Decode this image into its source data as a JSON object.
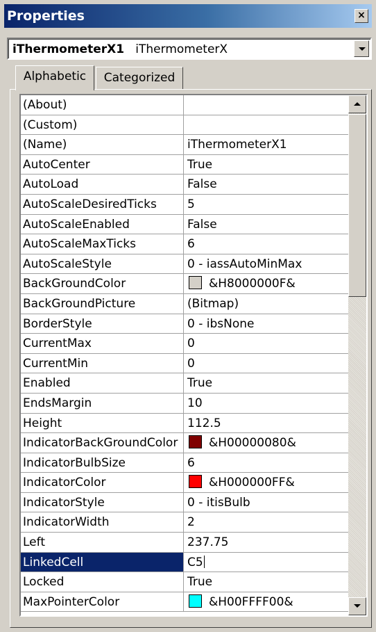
{
  "window": {
    "title": "Properties",
    "close_glyph": "×"
  },
  "object_selector": {
    "name": "iThermometerX1",
    "type": "iThermometerX"
  },
  "tabs": [
    {
      "label": "Alphabetic",
      "active": true
    },
    {
      "label": "Categorized",
      "active": false
    }
  ],
  "properties": [
    {
      "name": "(About)",
      "value": ""
    },
    {
      "name": "(Custom)",
      "value": ""
    },
    {
      "name": "(Name)",
      "value": "iThermometerX1"
    },
    {
      "name": "AutoCenter",
      "value": "True"
    },
    {
      "name": "AutoLoad",
      "value": "False"
    },
    {
      "name": "AutoScaleDesiredTicks",
      "value": "5"
    },
    {
      "name": "AutoScaleEnabled",
      "value": "False"
    },
    {
      "name": "AutoScaleMaxTicks",
      "value": "6"
    },
    {
      "name": "AutoScaleStyle",
      "value": "0 - iassAutoMinMax"
    },
    {
      "name": "BackGroundColor",
      "value": "&H8000000F&",
      "swatch": "#d4d0c8"
    },
    {
      "name": "BackGroundPicture",
      "value": "(Bitmap)"
    },
    {
      "name": "BorderStyle",
      "value": "0 - ibsNone"
    },
    {
      "name": "CurrentMax",
      "value": "0"
    },
    {
      "name": "CurrentMin",
      "value": "0"
    },
    {
      "name": "Enabled",
      "value": "True"
    },
    {
      "name": "EndsMargin",
      "value": "10"
    },
    {
      "name": "Height",
      "value": "112.5"
    },
    {
      "name": "IndicatorBackGroundColor",
      "value": "&H00000080&",
      "swatch": "#800000"
    },
    {
      "name": "IndicatorBulbSize",
      "value": "6"
    },
    {
      "name": "IndicatorColor",
      "value": "&H000000FF&",
      "swatch": "#ff0000"
    },
    {
      "name": "IndicatorStyle",
      "value": "0 - itisBulb"
    },
    {
      "name": "IndicatorWidth",
      "value": "2"
    },
    {
      "name": "Left",
      "value": "237.75"
    },
    {
      "name": "LinkedCell",
      "value": "C5",
      "selected": true,
      "editing": true
    },
    {
      "name": "Locked",
      "value": "True"
    },
    {
      "name": "MaxPointerColor",
      "value": "&H00FFFF00&",
      "swatch": "#00ffff"
    }
  ],
  "colors": {
    "title_start": "#0a246a",
    "title_end": "#a6caf0",
    "selection": "#0a246a"
  }
}
